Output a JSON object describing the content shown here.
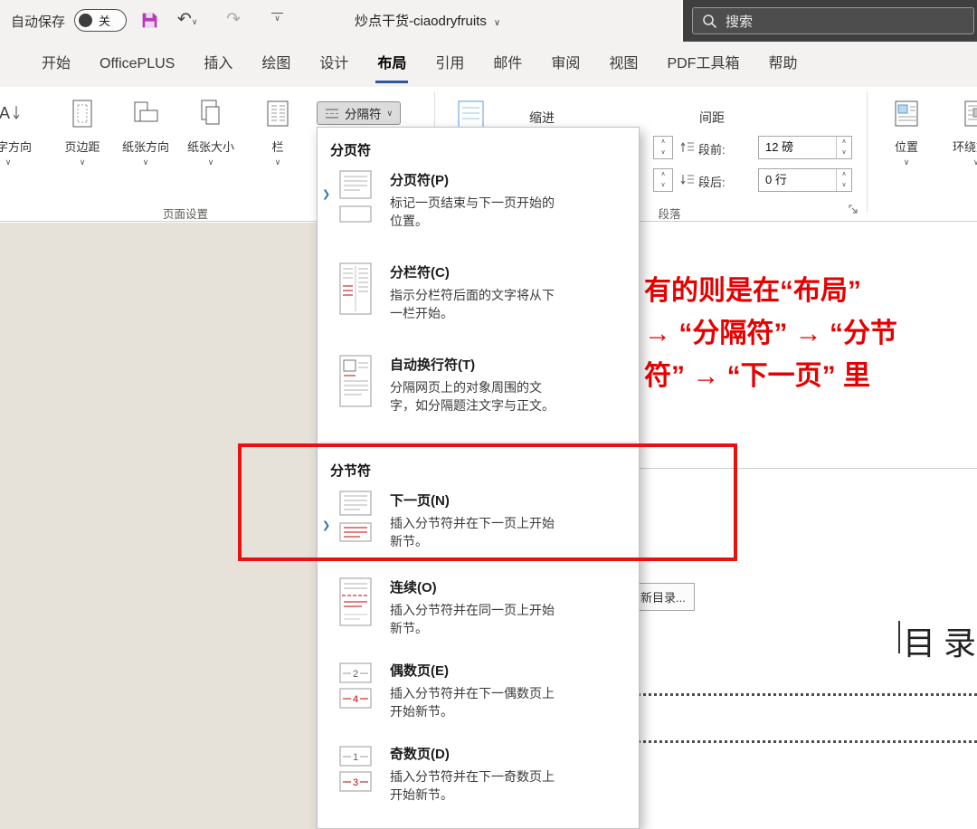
{
  "colors": {
    "annotation_red": "#e81111",
    "active_tab_underline": "#2b579a",
    "marker_blue": "#2e74b5",
    "break_line_red": "#c00000",
    "save_icon_magenta": "#b63ab6",
    "document_background": "#e7e2d9",
    "search_bar_dark": "#3f3f3f"
  },
  "title_bar": {
    "autosave_label": "自动保存",
    "autosave_state": "关",
    "document_title": "炒点干货-ciaodryfruits",
    "search_label": "搜索"
  },
  "ribbon": {
    "tabs": [
      {
        "label": "开始",
        "active": false
      },
      {
        "label": "OfficePLUS",
        "active": false
      },
      {
        "label": "插入",
        "active": false
      },
      {
        "label": "绘图",
        "active": false
      },
      {
        "label": "设计",
        "active": false
      },
      {
        "label": "布局",
        "active": true
      },
      {
        "label": "引用",
        "active": false
      },
      {
        "label": "邮件",
        "active": false
      },
      {
        "label": "审阅",
        "active": false
      },
      {
        "label": "视图",
        "active": false
      },
      {
        "label": "PDF工具箱",
        "active": false
      },
      {
        "label": "帮助",
        "active": false
      }
    ],
    "page_setup": {
      "group_label": "页面设置",
      "text_direction_label": "文字方向",
      "margins_label": "页边距",
      "orientation_label": "纸张方向",
      "size_label": "纸张大小",
      "columns_label": "栏",
      "breaks_label": "分隔符"
    },
    "paragraph": {
      "group_label": "段落",
      "indent_label": "缩进",
      "spacing_label": "间距",
      "space_before_label": "段前:",
      "space_before_value": "12 磅",
      "space_after_label": "段后:",
      "space_after_value": "0 行"
    },
    "arrange": {
      "position_label": "位置",
      "wrap_text_label": "环绕文字"
    }
  },
  "breaks_menu": {
    "page_breaks_header": "分页符",
    "section_breaks_header": "分节符",
    "items": [
      {
        "title": "分页符(P)",
        "desc": "标记一页结束与下一页开始的位置。"
      },
      {
        "title": "分栏符(C)",
        "desc": "指示分栏符后面的文字将从下一栏开始。"
      },
      {
        "title": "自动换行符(T)",
        "desc": "分隔网页上的对象周围的文字，如分隔题注文字与正文。"
      },
      {
        "title": "下一页(N)",
        "desc": "插入分节符并在下一页上开始新节。"
      },
      {
        "title": "连续(O)",
        "desc": "插入分节符并在同一页上开始新节。"
      },
      {
        "title": "偶数页(E)",
        "desc": "插入分节符并在下一偶数页上开始新节。"
      },
      {
        "title": "奇数页(D)",
        "desc": "插入分节符并在下一奇数页上开始新节。"
      }
    ]
  },
  "document": {
    "annotation_lines": [
      "有的则是在“布局”",
      "→ “分隔符” → “分节",
      "符” → “下一页” 里"
    ],
    "toc_button_label": "新目录...",
    "toc_heading": "目 录"
  }
}
